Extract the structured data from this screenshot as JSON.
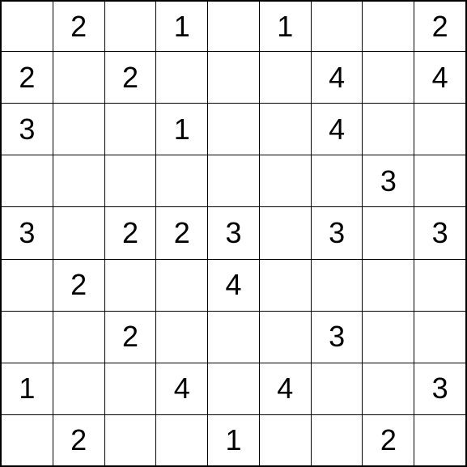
{
  "grid": {
    "size": 9,
    "cells": [
      [
        "",
        "2",
        "",
        "1",
        "",
        "1",
        "",
        "",
        "2"
      ],
      [
        "2",
        "",
        "2",
        "",
        "",
        "",
        "4",
        "",
        "4"
      ],
      [
        "3",
        "",
        "",
        "1",
        "",
        "",
        "4",
        "",
        ""
      ],
      [
        "",
        "",
        "",
        "",
        "",
        "",
        "",
        "3",
        ""
      ],
      [
        "3",
        "",
        "2",
        "2",
        "3",
        "",
        "3",
        "",
        "3"
      ],
      [
        "",
        "2",
        "",
        "",
        "4",
        "",
        "",
        "",
        ""
      ],
      [
        "",
        "",
        "2",
        "",
        "",
        "",
        "3",
        "",
        ""
      ],
      [
        "1",
        "",
        "",
        "4",
        "",
        "4",
        "",
        "",
        "3"
      ],
      [
        "",
        "2",
        "",
        "",
        "1",
        "",
        "",
        "2",
        ""
      ]
    ]
  }
}
